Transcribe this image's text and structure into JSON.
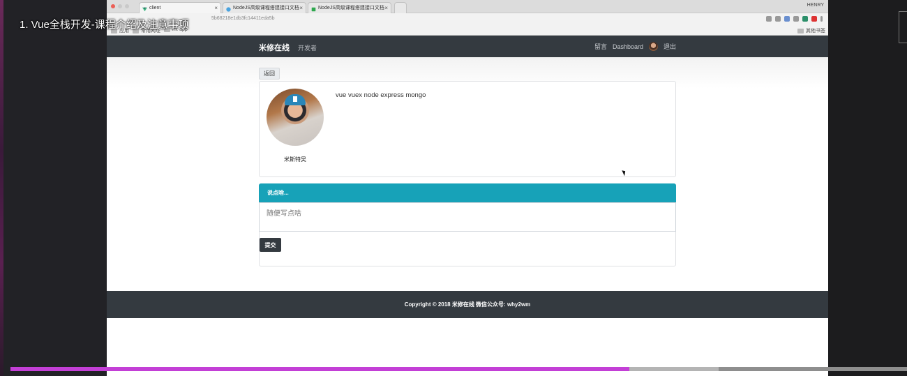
{
  "video": {
    "title": "1. Vue全栈开发-课程介绍及注意事项",
    "progress": 0.69,
    "buffered": 0.79,
    "progress_color": "#c33fd6"
  },
  "browser": {
    "tabs": [
      {
        "label": "client",
        "icon": "vue-logo-icon",
        "active": true
      },
      {
        "label": "NodeJS高级课程搭建接口文档",
        "icon": "globe-icon",
        "active": false
      },
      {
        "label": "NodeJS高级课程搭建接口文档",
        "icon": "doc-icon",
        "active": false
      }
    ],
    "user": "HENRY",
    "url": "5b68218e1db3fc14411eda5b",
    "bookmarks": [
      "应用",
      "常用网址",
      "mt-app"
    ],
    "other_bookmarks": "其他书签"
  },
  "navbar": {
    "brand": "米修在线",
    "developer": "开发者",
    "message": "留言",
    "dashboard": "Dashboard",
    "logout": "退出",
    "bg_color": "#343a40"
  },
  "page": {
    "back_label": "返回",
    "profile": {
      "name": "米斯特吴",
      "bio": "vue vuex node express mongo"
    },
    "comment": {
      "header": "说点啥...",
      "placeholder": "随便写点啥",
      "submit_label": "提交",
      "header_color": "#17a2b8"
    }
  },
  "footer": {
    "text": "Copyright © 2018 米修在线 微信公众号: why2wm"
  }
}
